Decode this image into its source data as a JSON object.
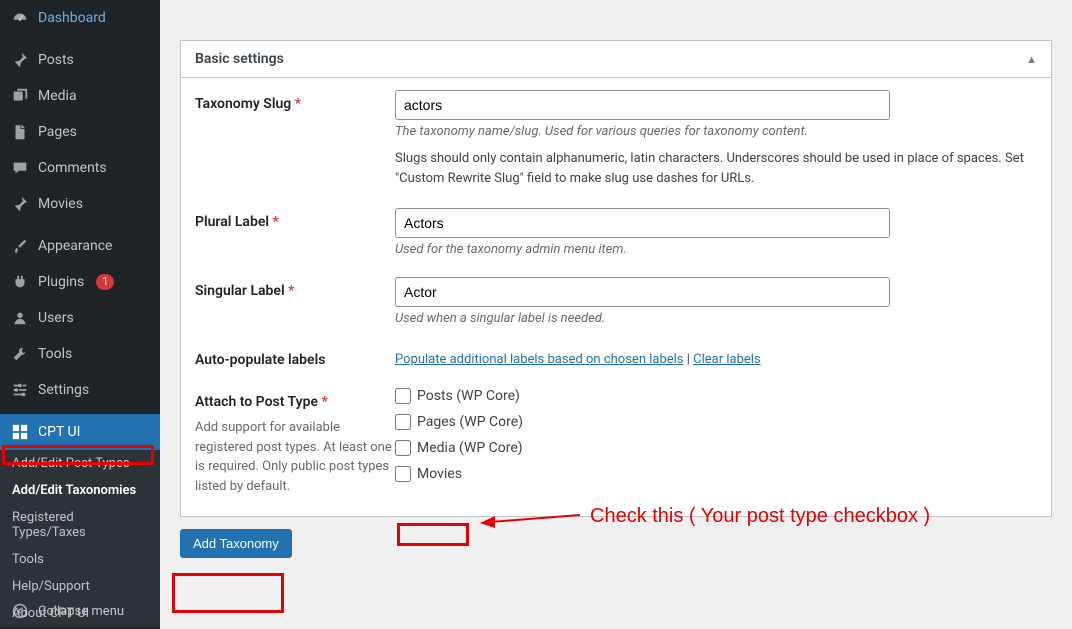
{
  "sidebar": {
    "items": [
      {
        "label": "Dashboard",
        "icon": "dashboard"
      },
      {
        "label": "Posts",
        "icon": "pin"
      },
      {
        "label": "Media",
        "icon": "media"
      },
      {
        "label": "Pages",
        "icon": "page"
      },
      {
        "label": "Comments",
        "icon": "comment"
      },
      {
        "label": "Movies",
        "icon": "pin"
      },
      {
        "label": "Appearance",
        "icon": "brush"
      },
      {
        "label": "Plugins",
        "icon": "plugin",
        "badge": "1"
      },
      {
        "label": "Users",
        "icon": "user"
      },
      {
        "label": "Tools",
        "icon": "wrench"
      },
      {
        "label": "Settings",
        "icon": "sliders"
      },
      {
        "label": "CPT UI",
        "icon": "cptui",
        "active": true
      }
    ],
    "submenu": [
      {
        "label": "Add/Edit Post Types"
      },
      {
        "label": "Add/Edit Taxonomies",
        "current": true
      },
      {
        "label": "Registered Types/Taxes"
      },
      {
        "label": "Tools"
      },
      {
        "label": "Help/Support"
      },
      {
        "label": "About CPT UI"
      }
    ],
    "collapse": "Collapse menu"
  },
  "panel": {
    "title": "Basic settings"
  },
  "fields": {
    "slug": {
      "label": "Taxonomy Slug",
      "value": "actors",
      "hint": "The taxonomy name/slug. Used for various queries for taxonomy content.",
      "note": "Slugs should only contain alphanumeric, latin characters. Underscores should be used in place of spaces. Set \"Custom Rewrite Slug\" field to make slug use dashes for URLs."
    },
    "plural": {
      "label": "Plural Label",
      "value": "Actors",
      "hint": "Used for the taxonomy admin menu item."
    },
    "singular": {
      "label": "Singular Label",
      "value": "Actor",
      "hint": "Used when a singular label is needed."
    },
    "autopop": {
      "label": "Auto-populate labels",
      "link1": "Populate additional labels based on chosen labels",
      "sep": " | ",
      "link2": "Clear labels"
    },
    "attach": {
      "label": "Attach to Post Type",
      "desc": "Add support for available registered post types. At least one is required. Only public post types listed by default.",
      "opts": [
        {
          "label": "Posts (WP Core)"
        },
        {
          "label": "Pages (WP Core)"
        },
        {
          "label": "Media (WP Core)"
        },
        {
          "label": "Movies"
        }
      ]
    }
  },
  "button": {
    "label": "Add Taxonomy"
  },
  "annotation": {
    "text": "Check this ( Your post type checkbox )"
  }
}
